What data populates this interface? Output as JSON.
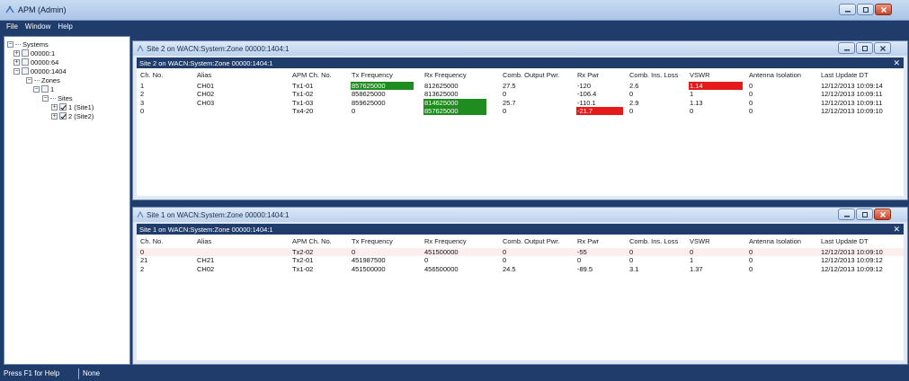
{
  "app": {
    "title": "APM (Admin)",
    "menu": [
      "File",
      "Window",
      "Help"
    ]
  },
  "tree": {
    "items": [
      {
        "label": "Systems",
        "kind": "root"
      },
      {
        "label": "00000:1"
      },
      {
        "label": "00000:64"
      },
      {
        "label": "00000:1404"
      },
      {
        "label": "Zones"
      },
      {
        "label": "1"
      },
      {
        "label": "Sites"
      },
      {
        "label": "1 (Site1)"
      },
      {
        "label": "2 (Site2)"
      }
    ]
  },
  "columns": [
    "Ch. No.",
    "Alias",
    "APM  Ch. No.",
    "Tx Frequency",
    "Rx Frequency",
    "Comb. Output Pwr.",
    "Rx Pwr",
    "Comb. Ins. Loss",
    "VSWR",
    "Antenna Isolation",
    "Last Update DT"
  ],
  "site2": {
    "window_title": "Site 2 on WACN:System:Zone 00000:1404:1",
    "banner": "Site 2 on WACN:System:Zone 00000:1404:1",
    "rows": [
      [
        "1",
        "CH01",
        "Tx1-01",
        "857625000",
        "812625000",
        "27.5",
        "-120",
        "2.6",
        "1.14",
        "0",
        "12/12/2013 10:09:14"
      ],
      [
        "2",
        "CH02",
        "Tx1-02",
        "858625000",
        "813625000",
        "0",
        "-106.4",
        "0",
        "1",
        "0",
        "12/12/2013 10:09:11"
      ],
      [
        "3",
        "CH03",
        "Tx1-03",
        "859625000",
        "814625000",
        "25.7",
        "-110.1",
        "2.9",
        "1.13",
        "0",
        "12/12/2013 10:09:11"
      ],
      [
        "0",
        "",
        "Tx4-20",
        "0",
        "857625000",
        "0",
        "-21.7",
        "0",
        "0",
        "0",
        "12/12/2013 10:09:10"
      ]
    ]
  },
  "site1": {
    "window_title": "Site 1 on WACN:System:Zone 00000:1404:1",
    "banner": "Site 1 on WACN:System:Zone 00000:1404:1",
    "rows": [
      [
        "0",
        "",
        "Tx2-02",
        "0",
        "451500000",
        "0",
        "-55",
        "0",
        "0",
        "0",
        "12/12/2013 10:09:10"
      ],
      [
        "21",
        "CH21",
        "Tx2-01",
        "451987500",
        "0",
        "0",
        "0",
        "0",
        "1",
        "0",
        "12/12/2013 10:09:12"
      ],
      [
        "2",
        "CH02",
        "Tx1-02",
        "451500000",
        "456500000",
        "24.5",
        "-89.5",
        "3.1",
        "1.37",
        "0",
        "12/12/2013 10:09:12"
      ]
    ]
  },
  "status": {
    "help": "Press F1  for Help",
    "mode": "None"
  },
  "colors": {
    "alarm_green": "#1e8c1e",
    "alarm_red": "#e51b1b",
    "banner_blue": "#1f3c6b"
  }
}
